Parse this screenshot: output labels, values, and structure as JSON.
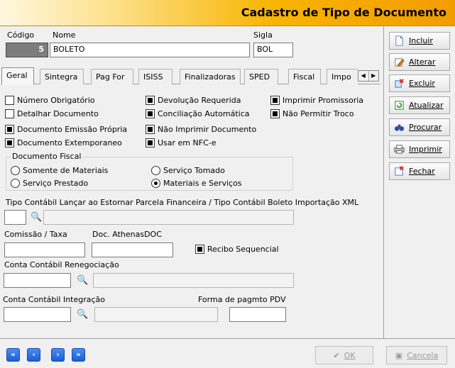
{
  "title": "Cadastro de Tipo de Documento",
  "header": {
    "codigo_label": "Código",
    "codigo_value": "5",
    "nome_label": "Nome",
    "nome_value": "BOLETO",
    "sigla_label": "Sigla",
    "sigla_value": "BOL"
  },
  "tabs": [
    "Geral",
    "Sintegra",
    "Pag For",
    "ISISS",
    "Finalizadoras",
    "SPED",
    "Fiscal",
    "Impo"
  ],
  "checkboxes": {
    "numero_obrigatorio": "Número Obrigatório",
    "detalhar_documento": "Detalhar Documento",
    "documento_emissao_propria": "Documento Emissão Própria",
    "documento_extemporaneo": "Documento Extemporaneo",
    "devolucao_requerida": "Devolução Requerida",
    "conciliacao_automatica": "Conciliação Automática",
    "nao_imprimir_documento": "Não Imprimir Documento",
    "usar_em_nfce": "Usar em NFC-e",
    "imprimir_promissoria": "Imprimir Promissoria",
    "nao_permitir_troco": "Não Permitir Troco",
    "recibo_sequencial": "Recibo Sequencial"
  },
  "documento_fiscal": {
    "legend": "Documento Fiscal",
    "options": [
      "Somente de Materiais",
      "Serviço Tomado",
      "Serviço Prestado",
      "Materiais e Serviços"
    ],
    "selected": "Materiais e Serviços"
  },
  "fields": {
    "tipo_contabil_label": "Tipo Contábil Lançar ao Estornar Parcela Financeira / Tipo Contábil Boleto Importação XML",
    "comissao_label": "Comissão / Taxa",
    "doc_athenas_label": "Doc. AthenasDOC",
    "conta_renegociacao_label": "Conta Contábil Renegociação",
    "conta_integracao_label": "Conta Contábil Integração",
    "forma_pagmto_label": "Forma de pagmto PDV"
  },
  "side_buttons": [
    "Incluir",
    "Alterar",
    "Excluir",
    "Atualizar",
    "Procurar",
    "Imprimir",
    "Fechar"
  ],
  "bottom": {
    "nav": [
      "first",
      "previous",
      "next",
      "last"
    ],
    "ok_label": "OK",
    "cancel_label": "Cancela"
  }
}
